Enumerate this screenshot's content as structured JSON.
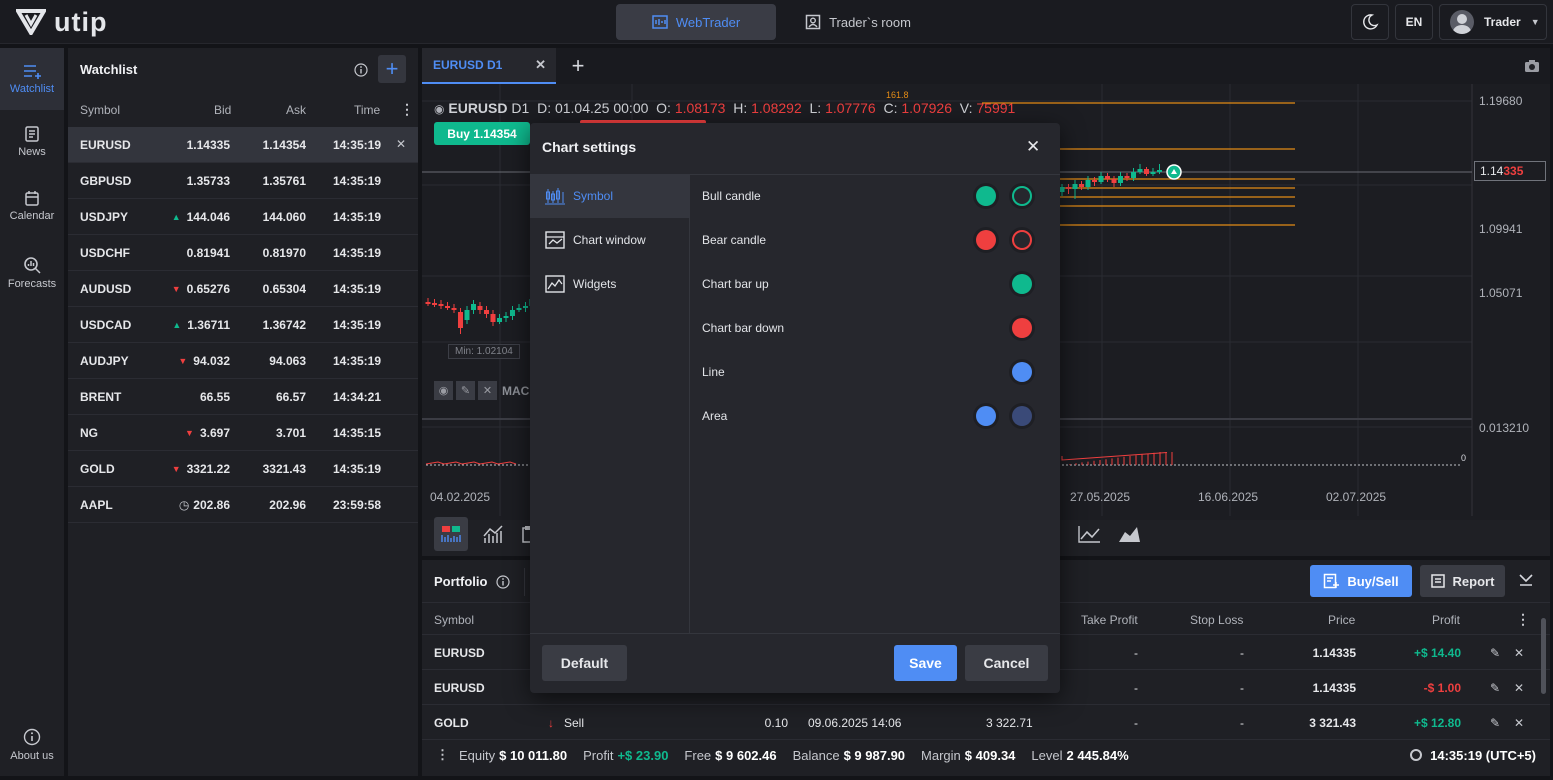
{
  "app": {
    "logo": "utip",
    "tabs": [
      {
        "label": "WebTrader"
      },
      {
        "label": "Trader`s room"
      }
    ],
    "lang": "EN",
    "user": "Trader"
  },
  "nav": [
    {
      "label": "Watchlist",
      "icon": "watchlist-icon"
    },
    {
      "label": "News",
      "icon": "news-icon"
    },
    {
      "label": "Calendar",
      "icon": "calendar-icon"
    },
    {
      "label": "Forecasts",
      "icon": "forecasts-icon"
    },
    {
      "label": "About us",
      "icon": "info-icon"
    }
  ],
  "watchlist": {
    "title": "Watchlist",
    "columns": [
      "Symbol",
      "Bid",
      "Ask",
      "Time"
    ],
    "rows": [
      {
        "symbol": "EURUSD",
        "bid": "1.14335",
        "ask": "1.14354",
        "time": "14:35:19",
        "dir": ""
      },
      {
        "symbol": "GBPUSD",
        "bid": "1.35733",
        "ask": "1.35761",
        "time": "14:35:19",
        "dir": ""
      },
      {
        "symbol": "USDJPY",
        "bid": "144.046",
        "ask": "144.060",
        "time": "14:35:19",
        "dir": "up"
      },
      {
        "symbol": "USDCHF",
        "bid": "0.81941",
        "ask": "0.81970",
        "time": "14:35:19",
        "dir": ""
      },
      {
        "symbol": "AUDUSD",
        "bid": "0.65276",
        "ask": "0.65304",
        "time": "14:35:19",
        "dir": "down"
      },
      {
        "symbol": "USDCAD",
        "bid": "1.36711",
        "ask": "1.36742",
        "time": "14:35:19",
        "dir": "up"
      },
      {
        "symbol": "AUDJPY",
        "bid": "94.032",
        "ask": "94.063",
        "time": "14:35:19",
        "dir": "down"
      },
      {
        "symbol": "BRENT",
        "bid": "66.55",
        "ask": "66.57",
        "time": "14:34:21",
        "dir": ""
      },
      {
        "symbol": "NG",
        "bid": "3.697",
        "ask": "3.701",
        "time": "14:35:15",
        "dir": "down"
      },
      {
        "symbol": "GOLD",
        "bid": "3321.22",
        "ask": "3321.43",
        "time": "14:35:19",
        "dir": "down"
      },
      {
        "symbol": "AAPL",
        "bid": "202.86",
        "ask": "202.96",
        "time": "23:59:58",
        "dir": "clock"
      }
    ]
  },
  "chart": {
    "tab": "EURUSD D1",
    "symbol": "EURUSD",
    "tf": "D1",
    "ohlc": {
      "d_label": "D:",
      "d": "01.04.25 00:00",
      "o_label": "O:",
      "o": "1.08173",
      "h_label": "H:",
      "h": "1.08292",
      "l_label": "L:",
      "l": "1.07776",
      "c_label": "C:",
      "c": "1.07926",
      "v_label": "V:",
      "v": "75991"
    },
    "buy": "Buy 1.14354",
    "fib": "161.8",
    "prices": [
      "1.19680",
      "1.09941",
      "1.05071"
    ],
    "current_price_a": "1.14",
    "current_price_b": "335",
    "min_label": "Min: 1.02104",
    "indicator": "MAC",
    "macd_value": "0.013210",
    "zero": "0",
    "dates": [
      "04.02.2025",
      "27.05.2025",
      "16.06.2025",
      "02.07.2025"
    ]
  },
  "modal": {
    "title": "Chart settings",
    "sidebar": [
      "Symbol",
      "Chart window",
      "Widgets"
    ],
    "rows": [
      {
        "label": "Bull candle",
        "colors": [
          "#0fb98e",
          "outline:#0fb98e"
        ]
      },
      {
        "label": "Bear candle",
        "colors": [
          "#ef3f3f",
          "outline:#ef3f3f"
        ]
      },
      {
        "label": "Chart bar up",
        "colors": [
          "#0fb98e"
        ]
      },
      {
        "label": "Chart bar down",
        "colors": [
          "#ef3f3f"
        ]
      },
      {
        "label": "Line",
        "colors": [
          "#4f8df4"
        ]
      },
      {
        "label": "Area",
        "colors": [
          "#4f8df4",
          "#3a4a78"
        ]
      }
    ],
    "default": "Default",
    "save": "Save",
    "cancel": "Cancel"
  },
  "portfolio": {
    "title": "Portfolio",
    "buysell": "Buy/Sell",
    "report": "Report",
    "columns": [
      "Symbol",
      "Take Profit",
      "Stop Loss",
      "Price",
      "Profit"
    ],
    "rows": [
      {
        "symbol": "EURUSD",
        "side": "",
        "volume": "",
        "open_time": "",
        "open_price": "",
        "tp": "-",
        "sl": "-",
        "price": "1.14335",
        "profit": "+$ 14.40",
        "pos": true
      },
      {
        "symbol": "EURUSD",
        "side": "",
        "volume": "",
        "open_time": "",
        "open_price": "",
        "tp": "-",
        "sl": "-",
        "price": "1.14335",
        "profit": "-$ 1.00",
        "pos": false
      },
      {
        "symbol": "GOLD",
        "side": "Sell",
        "volume": "0.10",
        "open_time": "09.06.2025 14:06",
        "open_price": "3 322.71",
        "tp": "-",
        "sl": "-",
        "price": "3 321.43",
        "profit": "+$ 12.80",
        "pos": true
      }
    ],
    "footer": {
      "equity_label": "Equity",
      "equity": "$ 10 011.80",
      "profit_label": "Profit",
      "profit": "+$ 23.90",
      "free_label": "Free",
      "free": "$ 9 602.46",
      "balance_label": "Balance",
      "balance": "$ 9 987.90",
      "margin_label": "Margin",
      "margin": "$ 409.34",
      "level_label": "Level",
      "level": "2 445.84%",
      "time": "14:35:19 (UTC+5)"
    }
  },
  "colors": {
    "accent": "#4f8df4",
    "up": "#0fb98e",
    "down": "#ef3f3f",
    "fib": "#e38b15"
  }
}
